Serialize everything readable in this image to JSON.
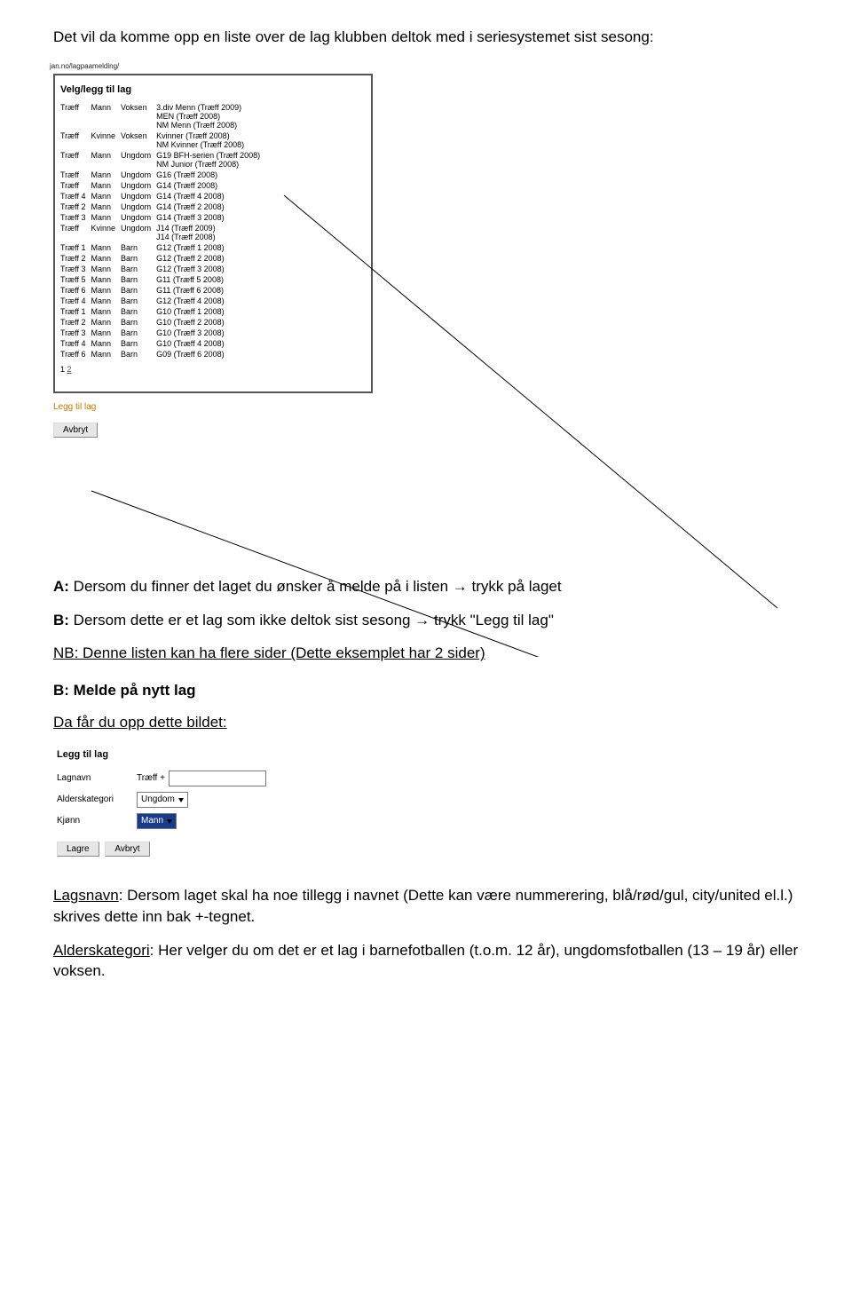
{
  "intro": "Det vil da komme opp en liste over de lag klubben deltok med i seriesystemet sist sesong:",
  "screenshot": {
    "urlfrag": "jan.no/lagpaamelding/",
    "title": "Velg/legg til lag",
    "rows": [
      {
        "c1": "Træff",
        "c2": "Mann",
        "c3": "Voksen",
        "c4": "3.div Menn (Træff 2009)\nMEN (Træff 2008)\nNM Menn (Træff 2008)"
      },
      {
        "c1": "Træff",
        "c2": "Kvinne",
        "c3": "Voksen",
        "c4": "Kvinner (Træff 2008)\nNM Kvinner (Træff 2008)"
      },
      {
        "c1": "Træff",
        "c2": "Mann",
        "c3": "Ungdom",
        "c4": "G19 BFH-serien (Træff 2008)\nNM Junior (Træff 2008)"
      },
      {
        "c1": "Træff",
        "c2": "Mann",
        "c3": "Ungdom",
        "c4": "G16 (Træff 2008)"
      },
      {
        "c1": "Træff",
        "c2": "Mann",
        "c3": "Ungdom",
        "c4": "G14 (Træff 2008)"
      },
      {
        "c1": "Træff 4",
        "c2": "Mann",
        "c3": "Ungdom",
        "c4": "G14 (Træff 4 2008)"
      },
      {
        "c1": "Træff 2",
        "c2": "Mann",
        "c3": "Ungdom",
        "c4": "G14 (Træff 2 2008)"
      },
      {
        "c1": "Træff 3",
        "c2": "Mann",
        "c3": "Ungdom",
        "c4": "G14 (Træff 3 2008)"
      },
      {
        "c1": "Træff",
        "c2": "Kvinne",
        "c3": "Ungdom",
        "c4": "J14 (Træff 2009)\nJ14 (Træff 2008)"
      },
      {
        "c1": "Træff 1",
        "c2": "Mann",
        "c3": "Barn",
        "c4": "G12 (Træff 1 2008)"
      },
      {
        "c1": "Træff 2",
        "c2": "Mann",
        "c3": "Barn",
        "c4": "G12 (Træff 2 2008)"
      },
      {
        "c1": "Træff 3",
        "c2": "Mann",
        "c3": "Barn",
        "c4": "G12 (Træff 3 2008)"
      },
      {
        "c1": "Træff 5",
        "c2": "Mann",
        "c3": "Barn",
        "c4": "G11 (Træff 5 2008)"
      },
      {
        "c1": "Træff 6",
        "c2": "Mann",
        "c3": "Barn",
        "c4": "G11 (Træff 6 2008)"
      },
      {
        "c1": "Træff 4",
        "c2": "Mann",
        "c3": "Barn",
        "c4": "G12 (Træff 4 2008)"
      },
      {
        "c1": "Træff 1",
        "c2": "Mann",
        "c3": "Barn",
        "c4": "G10 (Træff 1 2008)"
      },
      {
        "c1": "Træff 2",
        "c2": "Mann",
        "c3": "Barn",
        "c4": "G10 (Træff 2 2008)"
      },
      {
        "c1": "Træff 3",
        "c2": "Mann",
        "c3": "Barn",
        "c4": "G10 (Træff 3 2008)"
      },
      {
        "c1": "Træff 4",
        "c2": "Mann",
        "c3": "Barn",
        "c4": "G10 (Træff 4 2008)"
      },
      {
        "c1": "Træff 6",
        "c2": "Mann",
        "c3": "Barn",
        "c4": "G09 (Træff 6 2008)"
      }
    ],
    "pages": {
      "current": "1",
      "next": "2"
    },
    "addlink": "Legg til lag",
    "cancel": "Avbryt"
  },
  "body": {
    "a_label": "A:",
    "a_text": " Dersom du finner det laget du ønsker å melde på i listen → trykk på laget",
    "b_label": "B:",
    "b_text": " Dersom dette er et lag som ikke deltok sist sesong → trykk \"Legg til lag\"",
    "nb_text": "NB: Denne listen kan ha flere sider (Dette eksemplet har 2 sider)",
    "head_b": "B: Melde på nytt lag",
    "da_far": "Da får du opp dette bildet:"
  },
  "addform": {
    "title": "Legg til lag",
    "lagnavn_label": "Lagnavn",
    "lagnavn_prefix": "Træff +",
    "alder_label": "Alderskategori",
    "alder_value": "Ungdom",
    "kjonn_label": "Kjønn",
    "kjonn_value": "Mann",
    "lagre": "Lagre",
    "avbryt": "Avbryt"
  },
  "bottom": {
    "p1_lead": "Lagsnavn",
    "p1_rest": ": Dersom laget skal ha noe tillegg i navnet (Dette kan være nummerering, blå/rød/gul, city/united el.l.) skrives dette inn bak +-tegnet.",
    "p2_lead": "Alderskategori",
    "p2_rest": ": Her velger du om det er et lag i barnefotballen (t.o.m. 12 år), ungdomsfotballen (13 – 19 år) eller voksen."
  }
}
